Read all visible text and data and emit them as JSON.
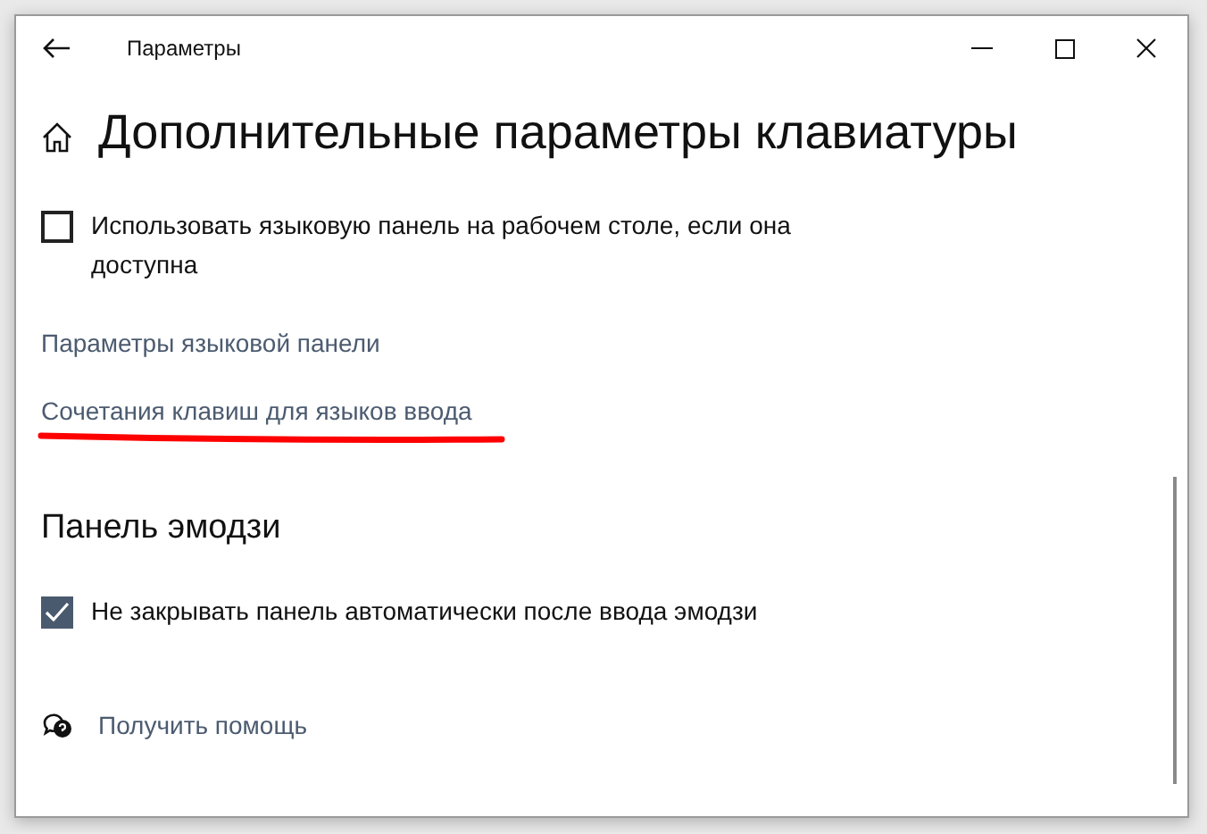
{
  "window": {
    "title": "Параметры"
  },
  "page_title": "Дополнительные параметры клавиатуры",
  "language_bar_option": {
    "label": "Использовать языковую панель на рабочем столе, если она доступна",
    "checked": false
  },
  "links": [
    {
      "label": "Параметры языковой панели",
      "underlined_in_red": false
    },
    {
      "label": "Сочетания клавиш для языков ввода",
      "underlined_in_red": true
    }
  ],
  "emoji_section": {
    "title": "Панель эмодзи",
    "option": {
      "label": "Не закрывать панель автоматически после ввода эмодзи",
      "checked": true
    }
  },
  "help_link": "Получить помощь"
}
